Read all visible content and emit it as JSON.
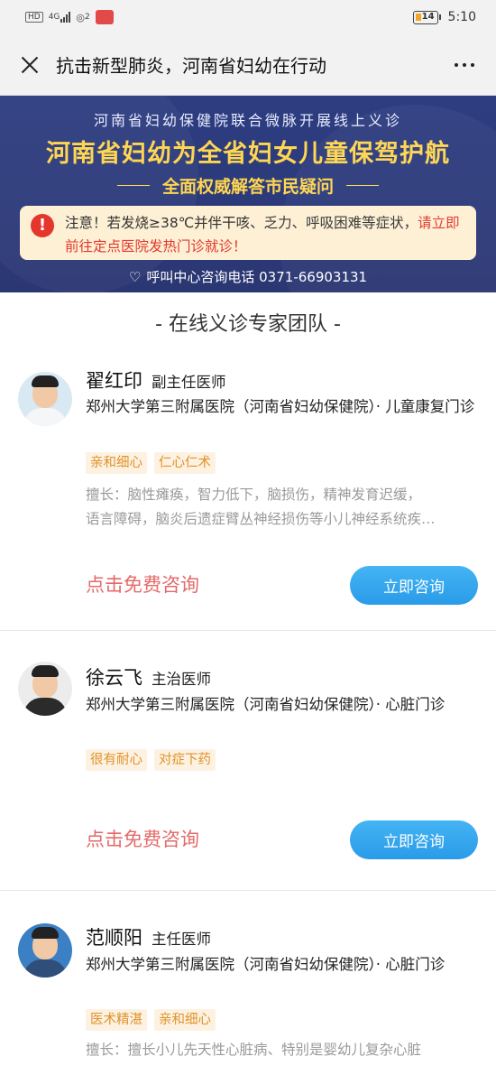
{
  "status_bar": {
    "left_icons": [
      "hd-icon",
      "4g-signal-icon",
      "hotspot-icon",
      "notification-badge-icon"
    ],
    "network": "4G",
    "hotspot_count": "2",
    "battery": "14",
    "time": "5:10"
  },
  "header": {
    "title": "抗击新型肺炎，河南省妇幼在行动"
  },
  "banner": {
    "line1": "河南省妇幼保健院联合微脉开展线上义诊",
    "headline": "河南省妇幼为全省妇女儿童保驾护航",
    "subheadline": "全面权威解答市民疑问",
    "notice_part1": "注意！若发烧≥38℃并伴干咳、乏力、呼吸困难等症状，",
    "notice_part2": "请立即前往定点医院发热门诊就诊！",
    "hotline": "呼叫中心咨询电话  0371-66903131"
  },
  "section": {
    "title": "- 在线义诊专家团队 -"
  },
  "doctors": [
    {
      "name": "翟红印",
      "title": "副主任医师",
      "hospital": "郑州大学第三附属医院（河南省妇幼保健院）· 儿童康复门诊",
      "tags": [
        "亲和细心",
        "仁心仁术"
      ],
      "skill_line1": "擅长：脑性瘫痪，智力低下，脑损伤，精神发育迟缓，",
      "skill_line2": "语言障碍，脑炎后遗症臂丛神经损伤等小儿神经系统疾…",
      "free_link": "点击免费咨询",
      "button": "立即咨询"
    },
    {
      "name": "徐云飞",
      "title": "主治医师",
      "hospital": "郑州大学第三附属医院（河南省妇幼保健院）· 心脏门诊",
      "tags": [
        "很有耐心",
        "对症下药"
      ],
      "free_link": "点击免费咨询",
      "button": "立即咨询"
    },
    {
      "name": "范顺阳",
      "title": "主任医师",
      "hospital": "郑州大学第三附属医院（河南省妇幼保健院）· 心脏门诊",
      "tags": [
        "医术精湛",
        "亲和细心"
      ],
      "skill_line1": "擅长：擅长小儿先天性心脏病、特别是婴幼儿复杂心脏"
    }
  ],
  "colors": {
    "banner_bg": "#2c3a7a",
    "banner_headline": "#ffd650",
    "tag_text": "#e0922a",
    "free_link": "#e46a6a",
    "button": "#2a9be8"
  }
}
